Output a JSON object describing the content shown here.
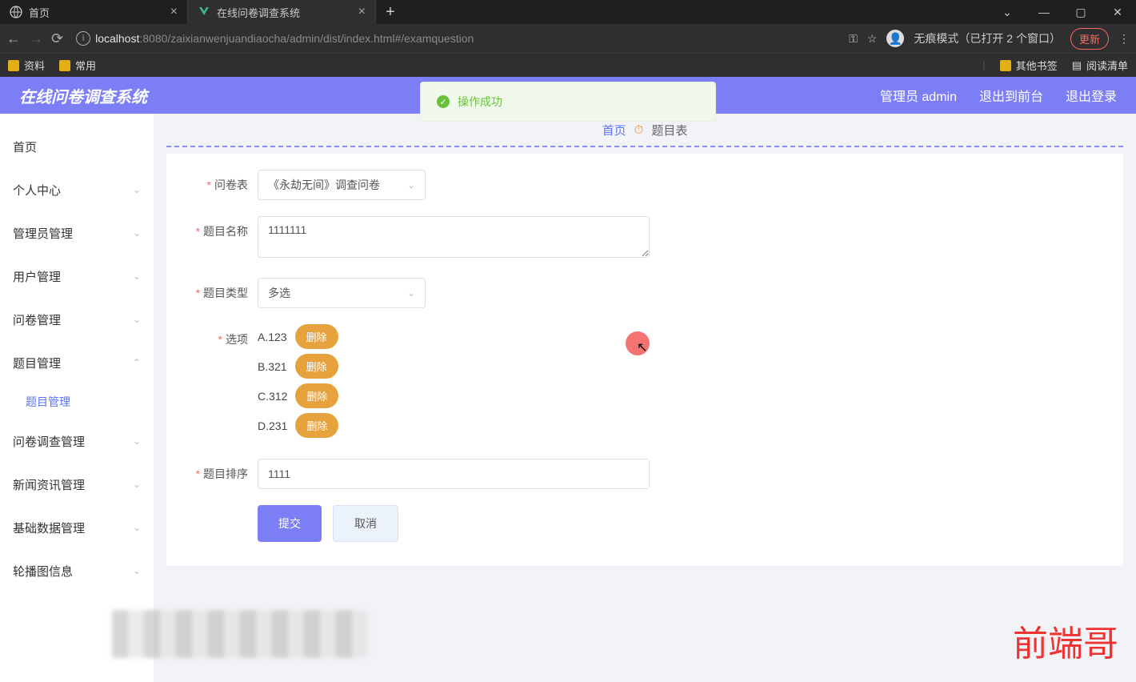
{
  "browser": {
    "tabs": [
      {
        "title": "首页"
      },
      {
        "title": "在线问卷调查系统"
      }
    ],
    "url_host": "localhost",
    "url_path": ":8080/zaixianwenjuandiaocha/admin/dist/index.html#/examquestion",
    "incognito_text": "无痕模式（已打开 2 个窗口）",
    "update_text": "更新",
    "bookmarks": [
      "资料",
      "常用"
    ],
    "bm_other": "其他书签",
    "bm_reading": "阅读清单"
  },
  "header": {
    "title": "在线问卷调查系统",
    "admin": "管理员 admin",
    "logout_front": "退出到前台",
    "logout": "退出登录"
  },
  "sidebar": {
    "home": "首页",
    "items": [
      "个人中心",
      "管理员管理",
      "用户管理",
      "问卷管理",
      "题目管理",
      "问卷调查管理",
      "新闻资讯管理",
      "基础数据管理",
      "轮播图信息"
    ],
    "sub_question": "题目管理"
  },
  "breadcrumb": {
    "home": "首页",
    "current": "题目表"
  },
  "form": {
    "survey_label": "问卷表",
    "survey_value": "《永劫无间》调查问卷",
    "name_label": "题目名称",
    "name_value": "1111111",
    "type_label": "题目类型",
    "type_value": "多选",
    "options_label": "选项",
    "options": [
      {
        "text": "A.123",
        "del": "删除"
      },
      {
        "text": "B.321",
        "del": "删除"
      },
      {
        "text": "C.312",
        "del": "删除"
      },
      {
        "text": "D.231",
        "del": "删除"
      }
    ],
    "order_label": "题目排序",
    "order_value": "1111",
    "submit": "提交",
    "cancel": "取消"
  },
  "toast": "操作成功",
  "watermark": "前端哥"
}
